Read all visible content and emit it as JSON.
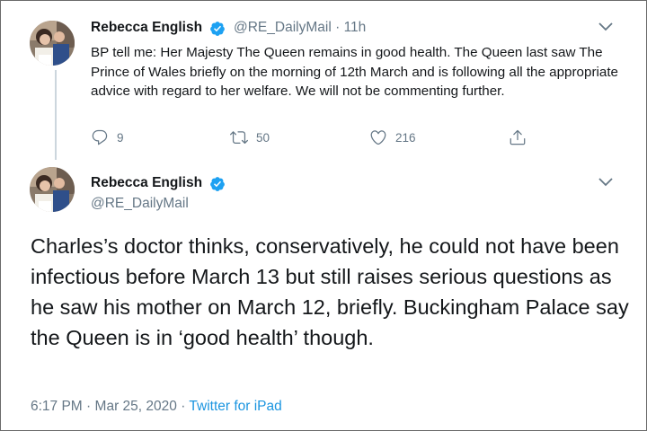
{
  "reply_tweet": {
    "author_name": "Rebecca English",
    "handle": "@RE_DailyMail",
    "separator": "·",
    "time_ago": "11h",
    "text": "BP tell me: Her Majesty The Queen remains in good health. The Queen last saw The Prince of Wales briefly on the morning of 12th March and is following all the appropriate advice with regard to her welfare. We will not be commenting further.",
    "reply_count": "9",
    "retweet_count": "50",
    "like_count": "216",
    "icons": [
      "verified-icon",
      "chevron-down-icon",
      "reply-icon",
      "retweet-icon",
      "like-icon",
      "share-icon"
    ]
  },
  "main_tweet": {
    "author_name": "Rebecca English",
    "handle": "@RE_DailyMail",
    "text": "Charles’s doctor thinks, conservatively, he could not have been infectious before March 13 but still raises serious questions as he saw his mother on March 12, briefly. Buckingham Palace say the Queen is in ‘good health’ though.",
    "time": "6:17 PM",
    "date": "Mar 25, 2020",
    "dot": "·",
    "source": "Twitter for iPad"
  },
  "colors": {
    "text": "#14171a",
    "muted": "#657786",
    "accent": "#1da1f2",
    "link": "#1b95e0",
    "thread_line": "#ccd6dd"
  }
}
